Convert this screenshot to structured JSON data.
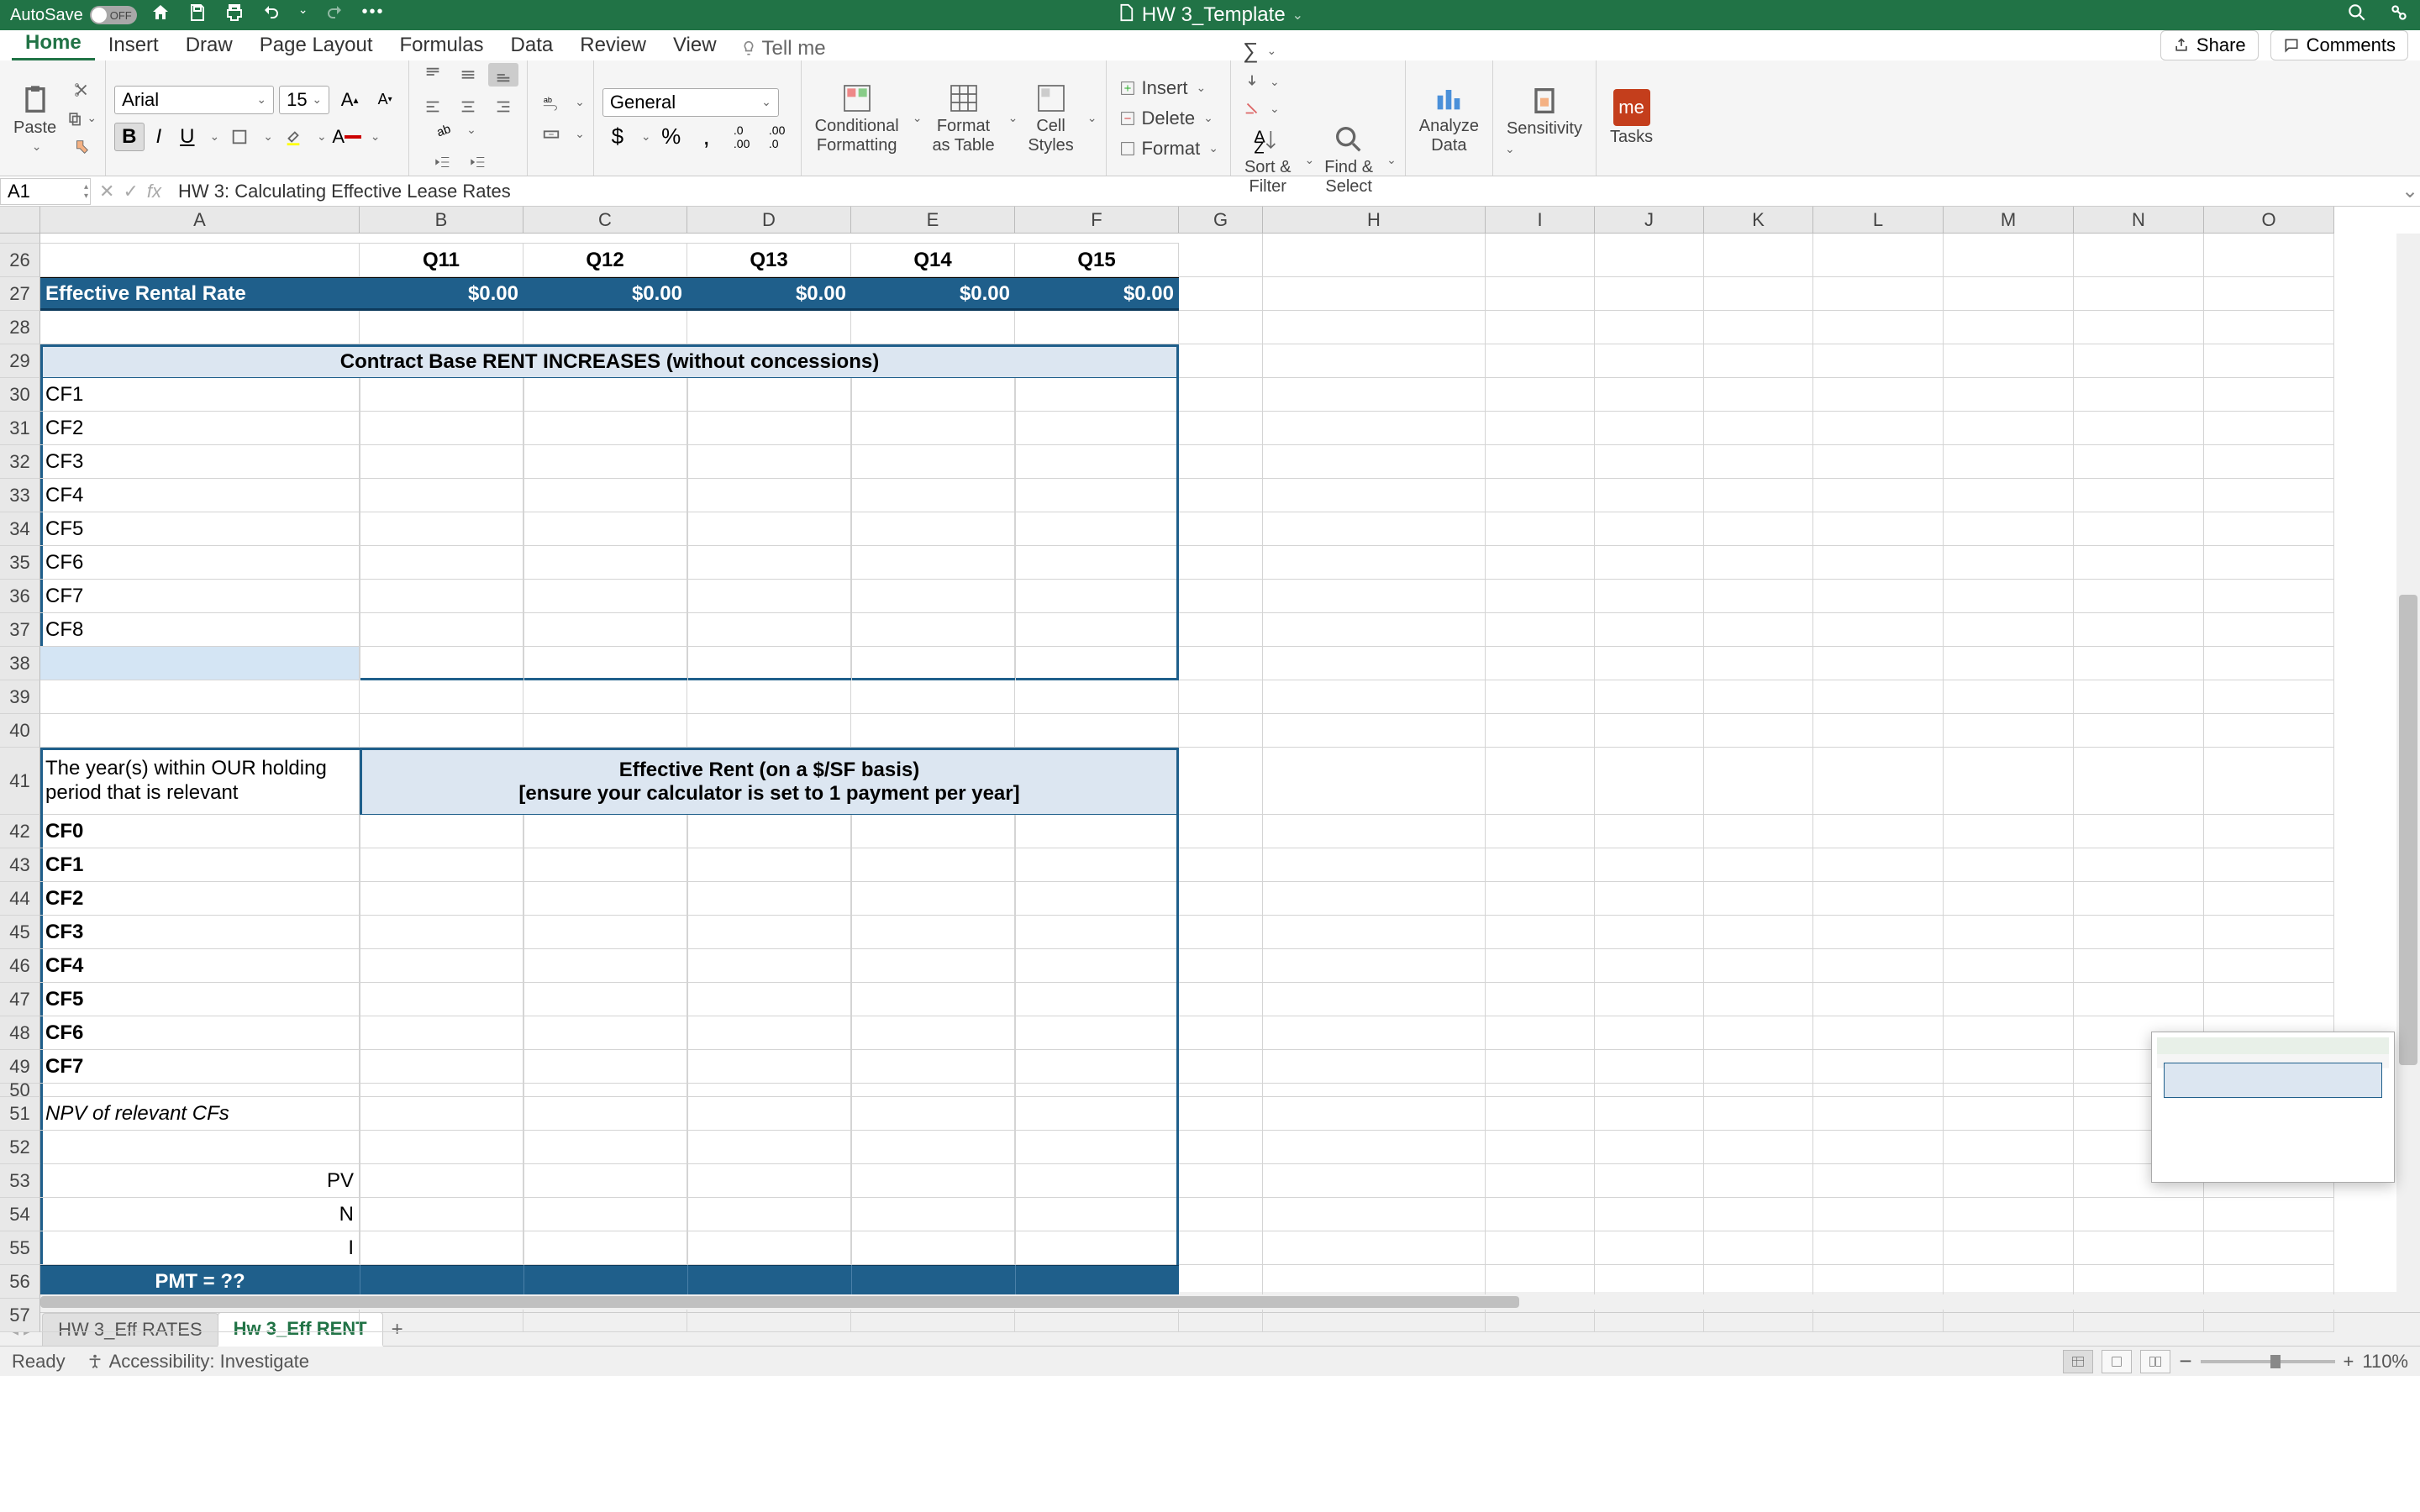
{
  "title_bar": {
    "autosave_label": "AutoSave",
    "autosave_state": "OFF",
    "doc_title": "HW 3_Template"
  },
  "ribbon_tabs": [
    "Home",
    "Insert",
    "Draw",
    "Page Layout",
    "Formulas",
    "Data",
    "Review",
    "View"
  ],
  "ribbon_active": "Home",
  "tell_me": "Tell me",
  "share_label": "Share",
  "comments_label": "Comments",
  "ribbon": {
    "paste": "Paste",
    "font_name": "Arial",
    "font_size": "15",
    "number_format": "General",
    "cond_fmt": "Conditional\nFormatting",
    "fmt_table": "Format\nas Table",
    "cell_styles": "Cell\nStyles",
    "insert": "Insert",
    "delete": "Delete",
    "format": "Format",
    "sort_filter": "Sort &\nFilter",
    "find_select": "Find &\nSelect",
    "analyze": "Analyze\nData",
    "sensitivity": "Sensitivity",
    "tasks": "Tasks",
    "me": "me"
  },
  "name_box": "A1",
  "formula": "HW 3: Calculating Effective Lease Rates",
  "cols": {
    "letters": [
      "A",
      "B",
      "C",
      "D",
      "E",
      "F",
      "G",
      "H",
      "I",
      "J",
      "K",
      "L",
      "M",
      "N",
      "O"
    ],
    "widths": [
      380,
      195,
      195,
      195,
      195,
      195,
      100,
      265,
      130,
      130,
      130,
      155,
      155,
      155,
      155
    ]
  },
  "row_start": 26,
  "row_end": 57,
  "row_h_default": 40,
  "rows": {
    "26": {
      "B": "Q11",
      "C": "Q12",
      "D": "Q13",
      "E": "Q14",
      "F": "Q15"
    },
    "27": {
      "A": "Effective Rental Rate",
      "B": "$0.00",
      "C": "$0.00",
      "D": "$0.00",
      "E": "$0.00",
      "F": "$0.00"
    },
    "29_header": "Contract Base RENT INCREASES (without concessions)",
    "30": {
      "A": "CF1"
    },
    "31": {
      "A": "CF2"
    },
    "32": {
      "A": "CF3"
    },
    "33": {
      "A": "CF4"
    },
    "34": {
      "A": "CF5"
    },
    "35": {
      "A": "CF6"
    },
    "36": {
      "A": "CF7"
    },
    "37": {
      "A": "CF8"
    },
    "41": {
      "A": "The year(s) within OUR holding period that is relevant"
    },
    "41_header_line1": "Effective Rent (on a $/SF basis)",
    "41_header_line2": "[ensure your calculator is set to 1 payment per year]",
    "42": {
      "A": "CF0"
    },
    "43": {
      "A": "CF1"
    },
    "44": {
      "A": "CF2"
    },
    "45": {
      "A": "CF3"
    },
    "46": {
      "A": "CF4"
    },
    "47": {
      "A": "CF5"
    },
    "48": {
      "A": "CF6"
    },
    "49": {
      "A": "CF7"
    },
    "51": {
      "A": "NPV of relevant CFs"
    },
    "53": {
      "A": "PV"
    },
    "54": {
      "A": "N"
    },
    "55": {
      "A": "I"
    },
    "56": {
      "A": "PMT = ??"
    }
  },
  "sheet_tabs": [
    "HW 3_Eff RATES",
    "Hw 3_Eff RENT"
  ],
  "sheet_active": 1,
  "status": {
    "ready": "Ready",
    "accessibility": "Accessibility: Investigate",
    "zoom": "110%"
  },
  "chart_data": {
    "type": "table",
    "title": "Effective Rental Rate by Question",
    "categories": [
      "Q11",
      "Q12",
      "Q13",
      "Q14",
      "Q15"
    ],
    "values": [
      0.0,
      0.0,
      0.0,
      0.0,
      0.0
    ]
  }
}
